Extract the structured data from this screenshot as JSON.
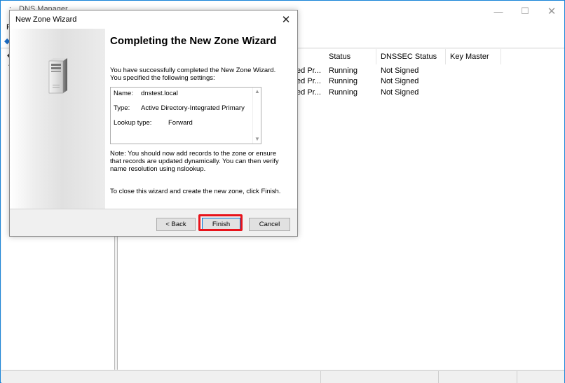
{
  "app": {
    "title": "DNS Manager",
    "menu_first_letter": "F",
    "window_buttons": {
      "minimize": "—",
      "maximize": "☐",
      "close": "✕"
    },
    "columns": [
      "Status",
      "DNSSEC Status",
      "Key Master"
    ],
    "rows": [
      {
        "type_fragment": "ted Pr...",
        "status": "Running",
        "dnssec": "Not Signed",
        "key_master": ""
      },
      {
        "type_fragment": "ted Pr...",
        "status": "Running",
        "dnssec": "Not Signed",
        "key_master": ""
      },
      {
        "type_fragment": "ted Pr...",
        "status": "Running",
        "dnssec": "Not Signed",
        "key_master": ""
      }
    ]
  },
  "dialog": {
    "title": "New Zone Wizard",
    "close_glyph": "✕",
    "heading": "Completing the New Zone Wizard",
    "intro": "You have successfully completed the New Zone Wizard. You specified the following settings:",
    "settings": [
      {
        "label": "Name:",
        "value": "dnstest.local"
      },
      {
        "label": "Type:",
        "value": "Active Directory-Integrated Primary"
      },
      {
        "label": "Lookup type:",
        "value": "Forward"
      }
    ],
    "note": "Note: You should now add records to the zone or ensure that records are updated dynamically. You can then verify name resolution using nslookup.",
    "close_instruction": "To close this wizard and create the new zone, click Finish.",
    "buttons": {
      "back": "< Back",
      "finish": "Finish",
      "cancel": "Cancel"
    }
  },
  "icons": [
    "server-icon",
    "close-icon",
    "scroll-up-icon",
    "scroll-down-icon",
    "app-icon",
    "toolbar-back-icon",
    "tree-expand-icon"
  ],
  "colors": {
    "highlight": "#e8131b",
    "window_border": "#1883d7",
    "default_button_border": "#0078d7"
  }
}
